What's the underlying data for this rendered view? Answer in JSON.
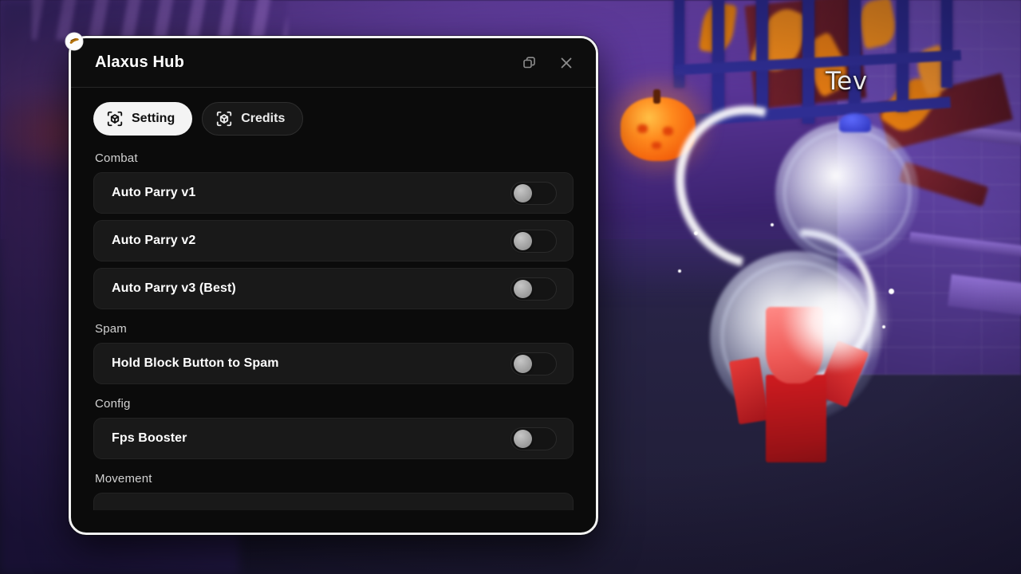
{
  "game": {
    "player_nameplate": "Tev",
    "scene_description": "halloween-roblox-arena",
    "colors": {
      "wall_purple": "#6a42ad",
      "ground_navy": "#23203c",
      "fence_blue": "#2b2a8c",
      "pumpkin_orange": "#ff8a1e",
      "character_red": "#d8242b",
      "glow_white": "#ffffff"
    }
  },
  "panel": {
    "title": "Alaxus Hub",
    "window_controls": [
      {
        "name": "restore-window-button",
        "icon": "restore-icon"
      },
      {
        "name": "close-window-button",
        "icon": "close-icon"
      }
    ],
    "tabs": [
      {
        "label": "Setting",
        "icon": "scan-cube-icon",
        "active": true
      },
      {
        "label": "Credits",
        "icon": "scan-cube-icon",
        "active": false
      }
    ],
    "sections": [
      {
        "title": "Combat",
        "options": [
          {
            "label": "Auto Parry v1",
            "toggle": "off"
          },
          {
            "label": "Auto Parry v2",
            "toggle": "off"
          },
          {
            "label": "Auto Parry v3 (Best)",
            "toggle": "off"
          }
        ]
      },
      {
        "title": "Spam",
        "options": [
          {
            "label": "Hold Block Button to Spam",
            "toggle": "off"
          }
        ]
      },
      {
        "title": "Config",
        "options": [
          {
            "label": "Fps Booster",
            "toggle": "off"
          }
        ]
      },
      {
        "title": "Movement",
        "options": []
      }
    ],
    "colors": {
      "panel_background": "#0b0b0b",
      "panel_border": "#f2f2f2",
      "row_background": "#191919",
      "active_tab_background": "#f4f4f4",
      "text_primary": "#ffffff",
      "text_section": "#d2d2d2",
      "toggle_knob": "#9a9a9a"
    }
  }
}
